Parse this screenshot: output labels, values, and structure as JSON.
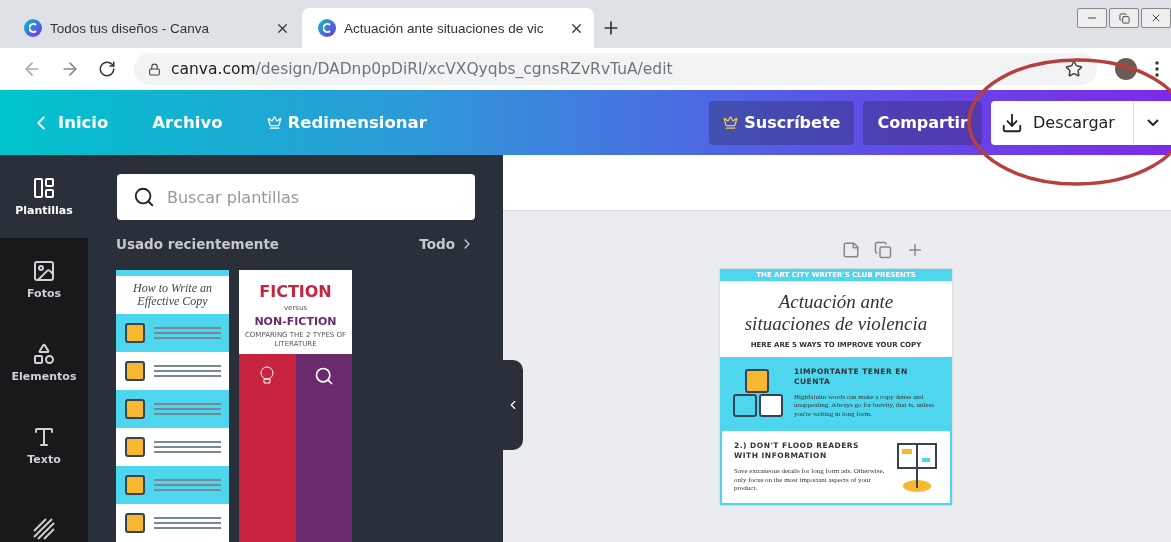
{
  "browser": {
    "tabs": [
      {
        "title": "Todos tus diseños - Canva",
        "selected": false
      },
      {
        "title": "Actuación ante situaciones de vic",
        "selected": true
      }
    ],
    "url": {
      "host": "canva.com",
      "path": "/design/DADnp0pDiRI/xcVXQyqbs_cgnsRZvRvTuA/edit"
    }
  },
  "header": {
    "nav": [
      {
        "label": "Inicio",
        "kind": "back"
      },
      {
        "label": "Archivo",
        "kind": "plain"
      },
      {
        "label": "Redimensionar",
        "kind": "crown"
      }
    ],
    "subscribe": "Suscríbete",
    "share": "Compartir",
    "download": "Descargar"
  },
  "rail": [
    {
      "label": "Plantillas",
      "kind": "templates",
      "selected": true
    },
    {
      "label": "Fotos",
      "kind": "photos",
      "selected": false
    },
    {
      "label": "Elementos",
      "kind": "elements",
      "selected": false
    },
    {
      "label": "Texto",
      "kind": "text",
      "selected": false
    },
    {
      "kind": "styles",
      "selected": false
    }
  ],
  "panel": {
    "search": {
      "placeholder": "Buscar plantillas"
    },
    "section": "Usado recientemente",
    "see_all": "Todo"
  },
  "thumbnails": [
    {
      "kind": "copy",
      "title": "How to Write an Effective Copy"
    },
    {
      "kind": "fiction",
      "title": "FICTION",
      "versus": "versus",
      "subtitle": "NON-FICTION",
      "caption": "COMPARING THE 2 TYPES OF LITERATURE"
    }
  ],
  "design": {
    "banner": "THE ART CITY WRITER'S CLUB PRESENTS",
    "title": "Actuación ante situaciones de violencia",
    "subtitle": "HERE ARE 5 WAYS TO IMPROVE YOUR COPY",
    "sections": [
      {
        "kind": "abc",
        "heading": "1IMPORTANTE TENER EN CUENTA",
        "body": "Highfalutin words can make a copy dense and unappealing. Always go for brevity, that is, unless you're writing in long form."
      },
      {
        "kind": "book",
        "heading": "2.) DON'T FLOOD READERS WITH INFORMATION",
        "body": "Save extraneous details for long form ads. Otherwise, only focus on the most important aspects of your product."
      }
    ]
  }
}
